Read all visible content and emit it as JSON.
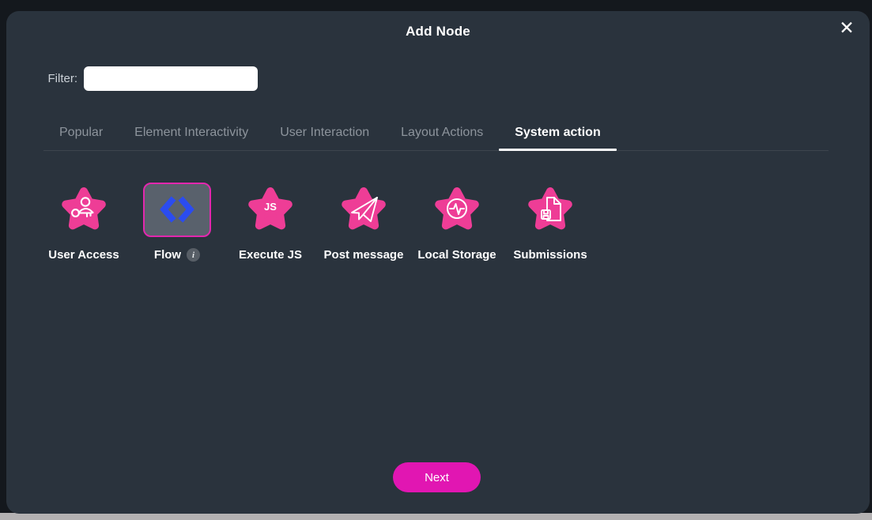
{
  "dialog": {
    "title": "Add Node",
    "close_glyph": "✕"
  },
  "filter": {
    "label": "Filter:",
    "value": ""
  },
  "tabs": [
    {
      "label": "Popular",
      "active": false
    },
    {
      "label": "Element Interactivity",
      "active": false
    },
    {
      "label": "User Interaction",
      "active": false
    },
    {
      "label": "Layout Actions",
      "active": false
    },
    {
      "label": "System action",
      "active": true
    }
  ],
  "nodes": [
    {
      "label": "User Access",
      "icon": "user-key-star"
    },
    {
      "label": "Flow",
      "icon": "code-brackets-tile",
      "selected": true,
      "info_badge": "i"
    },
    {
      "label": "Execute JS",
      "icon": "js-star",
      "badge": "JS"
    },
    {
      "label": "Post message",
      "icon": "paper-plane-star"
    },
    {
      "label": "Local Storage",
      "icon": "pulse-star"
    },
    {
      "label": "Submissions",
      "icon": "document-star"
    }
  ],
  "footer": {
    "next_label": "Next"
  },
  "colors": {
    "modal_bg": "#2a333d",
    "backdrop": "#14181d",
    "star_pink": "#ee3d96",
    "next_magenta": "#e116b2",
    "selected_border": "#e327ae",
    "flow_blue": "#2b4cf0",
    "tab_inactive": "#8d949c",
    "tab_active": "#ffffff"
  }
}
